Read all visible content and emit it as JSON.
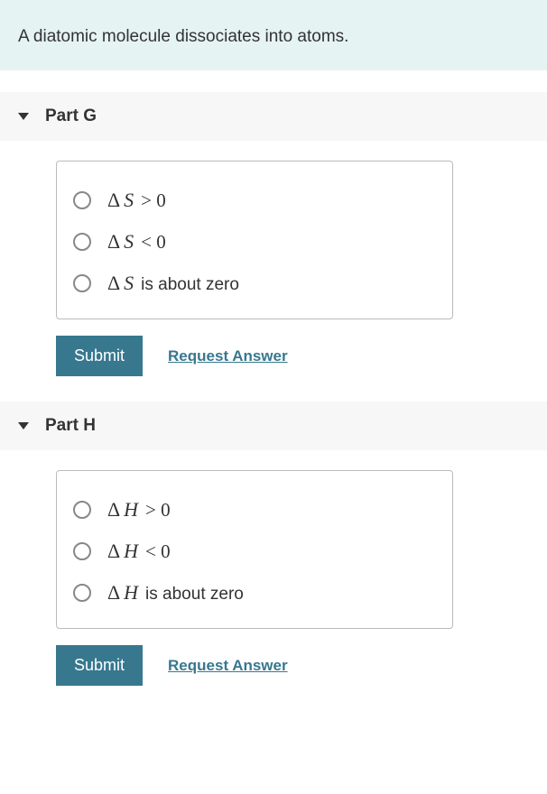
{
  "prompt": "A diatomic molecule dissociates into atoms.",
  "parts": [
    {
      "title": "Part G",
      "options": [
        {
          "delta": "Δ",
          "var": "S",
          "rest_math": "> 0",
          "rest_text": ""
        },
        {
          "delta": "Δ",
          "var": "S",
          "rest_math": "< 0",
          "rest_text": ""
        },
        {
          "delta": "Δ",
          "var": "S",
          "rest_math": "",
          "rest_text": "is about zero"
        }
      ],
      "submit_label": "Submit",
      "request_label": "Request Answer"
    },
    {
      "title": "Part H",
      "options": [
        {
          "delta": "Δ",
          "var": "H",
          "rest_math": "> 0",
          "rest_text": ""
        },
        {
          "delta": "Δ",
          "var": "H",
          "rest_math": "< 0",
          "rest_text": ""
        },
        {
          "delta": "Δ",
          "var": "H",
          "rest_math": "",
          "rest_text": "is about zero"
        }
      ],
      "submit_label": "Submit",
      "request_label": "Request Answer"
    }
  ]
}
